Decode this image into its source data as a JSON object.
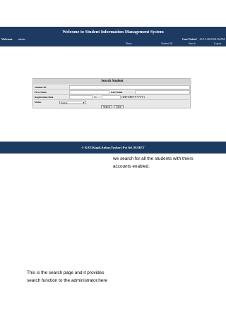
{
  "header": {
    "title": "Welcome to Student Information Management System",
    "welcome_label": "Welcome",
    "username": "admin",
    "last_visited_label": "Last Visited",
    "last_visited_value": "25-12-2010 09:16 PM"
  },
  "nav": {
    "items": [
      "Home",
      "Student All",
      "Search",
      "Logout"
    ]
  },
  "search_form": {
    "title": "Search Student",
    "student_id_label": "Student ID",
    "first_name_label": "First Name",
    "last_name_label": "Last Name",
    "registration_date_label": "Registration Date",
    "to_label": "To",
    "date_format_hint": "(DD-MM-YYYY)",
    "status_label": "Status",
    "status_value": "Enable",
    "search_button": "Search",
    "clear_button": "Clear"
  },
  "footer": {
    "copyright": "© KAT(Kapil,Ankur,Tushar) Pvt ltd. MAIET"
  },
  "captions": {
    "top_line1": "we search for all the students with theirs",
    "top_line2": "accounts enabled.",
    "bottom_line1": "This is the search page and it provides",
    "bottom_line2": "search function to the administrator.here"
  }
}
